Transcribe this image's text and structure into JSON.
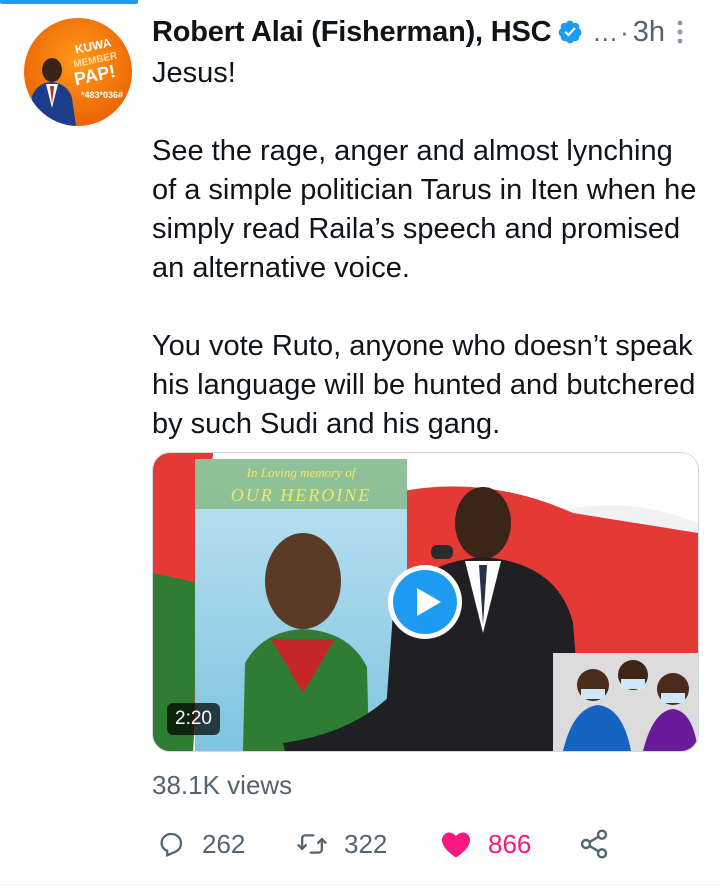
{
  "tweet": {
    "author_name": "Robert Alai (Fisherman), HSC",
    "handle_ellipsis": "...",
    "dot": "·",
    "time": "3h",
    "paragraphs": [
      "Jesus!",
      "See the rage, anger and almost lynching of a simple politician Tarus in Iten when he simply read Raila’s speech and promised an alternative voice.",
      "You vote Ruto, anyone who doesn’t speak his language will be hunted and butchered by such Sudi and his gang."
    ]
  },
  "avatar": {
    "badge_line1": "KUWA",
    "badge_line2": "MEMBER",
    "badge_line3": "PAP!",
    "code": "*483*036#"
  },
  "video": {
    "duration": "2:20",
    "banner_line1": "In Loving memory of",
    "banner_line2": "OUR HEROINE"
  },
  "stats": {
    "views": "38.1K views"
  },
  "actions": {
    "replies": "262",
    "retweets": "322",
    "likes": "866"
  },
  "colors": {
    "accent": "#1d9bf0",
    "like": "#f91880",
    "muted": "#536471"
  }
}
